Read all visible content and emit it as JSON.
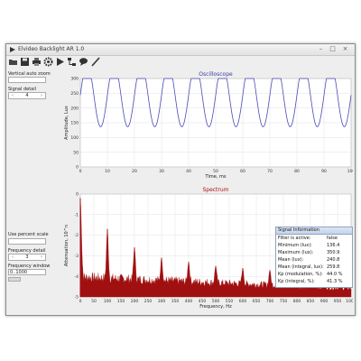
{
  "window": {
    "title": "Elvideo Backlight AR 1.0",
    "controls": [
      "minimize-icon",
      "maximize-icon",
      "close-icon"
    ]
  },
  "toolbar": {
    "buttons": [
      "open-icon",
      "save-icon",
      "print-icon",
      "settings-icon",
      "play-icon",
      "network-icon",
      "comment-icon",
      "brush-icon"
    ]
  },
  "left_panel": {
    "vertical_auto_zoom_label": "Vertical auto zoom",
    "signal_detail_label": "Signal detail",
    "signal_detail_value": "4",
    "use_percent_scale_label": "Use percent scale",
    "frequency_detail_label": "Frequency detail",
    "frequency_detail_value": "3",
    "frequency_window_label": "Frequency window",
    "frequency_window_value": "0..1000"
  },
  "colors": {
    "oscilloscope_line": "#4a4ab8",
    "oscilloscope_title": "#3a3aa8",
    "spectrum_fill": "#a01010",
    "spectrum_title": "#b01010"
  },
  "chart_data": [
    {
      "type": "line",
      "title": "Oscilloscope",
      "xlabel": "Time, ms",
      "ylabel": "Amplitude, Lux",
      "xlim": [
        0,
        100
      ],
      "ylim": [
        0,
        300
      ],
      "x_ticks": [
        "0",
        "10",
        "20",
        "30",
        "40",
        "50",
        "60",
        "70",
        "80",
        "90",
        "100"
      ],
      "y_ticks": [
        "0",
        "50",
        "100",
        "150",
        "200",
        "250",
        "300"
      ],
      "grid": true,
      "series": [
        {
          "frequency_hz": 100,
          "min": 136.4,
          "max": 350.9,
          "x": [
            0,
            5,
            10,
            15,
            20,
            25,
            30,
            35,
            40,
            45,
            50,
            55,
            60,
            65,
            70,
            75,
            80,
            85,
            90,
            95,
            100
          ],
          "y": [
            240.8,
            350.9,
            240.8,
            136.4,
            240.8,
            350.9,
            240.8,
            136.4,
            240.8,
            350.9,
            240.8,
            136.4,
            240.8,
            350.9,
            240.8,
            136.4,
            240.8,
            350.9,
            240.8,
            136.4,
            240.8
          ]
        }
      ]
    },
    {
      "type": "area",
      "title": "Spectrum",
      "xlabel": "Frequency, Hz",
      "ylabel": "Attenuation, 10^n",
      "xlim": [
        0,
        1000
      ],
      "ylim": [
        -5,
        0
      ],
      "x_ticks": [
        "0",
        "50",
        "100",
        "150",
        "200",
        "250",
        "300",
        "350",
        "400",
        "450",
        "500",
        "550",
        "600",
        "650",
        "700",
        "750",
        "800",
        "850",
        "900",
        "950",
        "1000"
      ],
      "y_ticks": [
        "0",
        "-1",
        "-2",
        "-3",
        "-4",
        "-5"
      ],
      "grid": true,
      "baseline_range": [
        -4.7,
        -4.0
      ],
      "peaks": [
        {
          "x": 0,
          "y": -0.2
        },
        {
          "x": 100,
          "y": -1.7
        },
        {
          "x": 200,
          "y": -2.6
        },
        {
          "x": 300,
          "y": -3.1
        },
        {
          "x": 400,
          "y": -3.3
        },
        {
          "x": 500,
          "y": -3.5
        },
        {
          "x": 600,
          "y": -3.6
        },
        {
          "x": 700,
          "y": -3.7
        },
        {
          "x": 800,
          "y": -3.75
        },
        {
          "x": 900,
          "y": -3.8
        }
      ]
    }
  ],
  "signal_info": {
    "title": "Signal Information",
    "rows": [
      {
        "label": "Filter is active:",
        "value": "false"
      },
      {
        "label": "Minimum (lux):",
        "value": "136.4"
      },
      {
        "label": "Maximum (lux):",
        "value": "350.9"
      },
      {
        "label": "Mean (lux):",
        "value": "240.8"
      },
      {
        "label": "Mean (integral, lux):",
        "value": "259.8"
      },
      {
        "label": "Kp (modulation, %):",
        "value": "44.0 %"
      },
      {
        "label": "Kp (integral, %):",
        "value": "41.3 %"
      }
    ]
  }
}
